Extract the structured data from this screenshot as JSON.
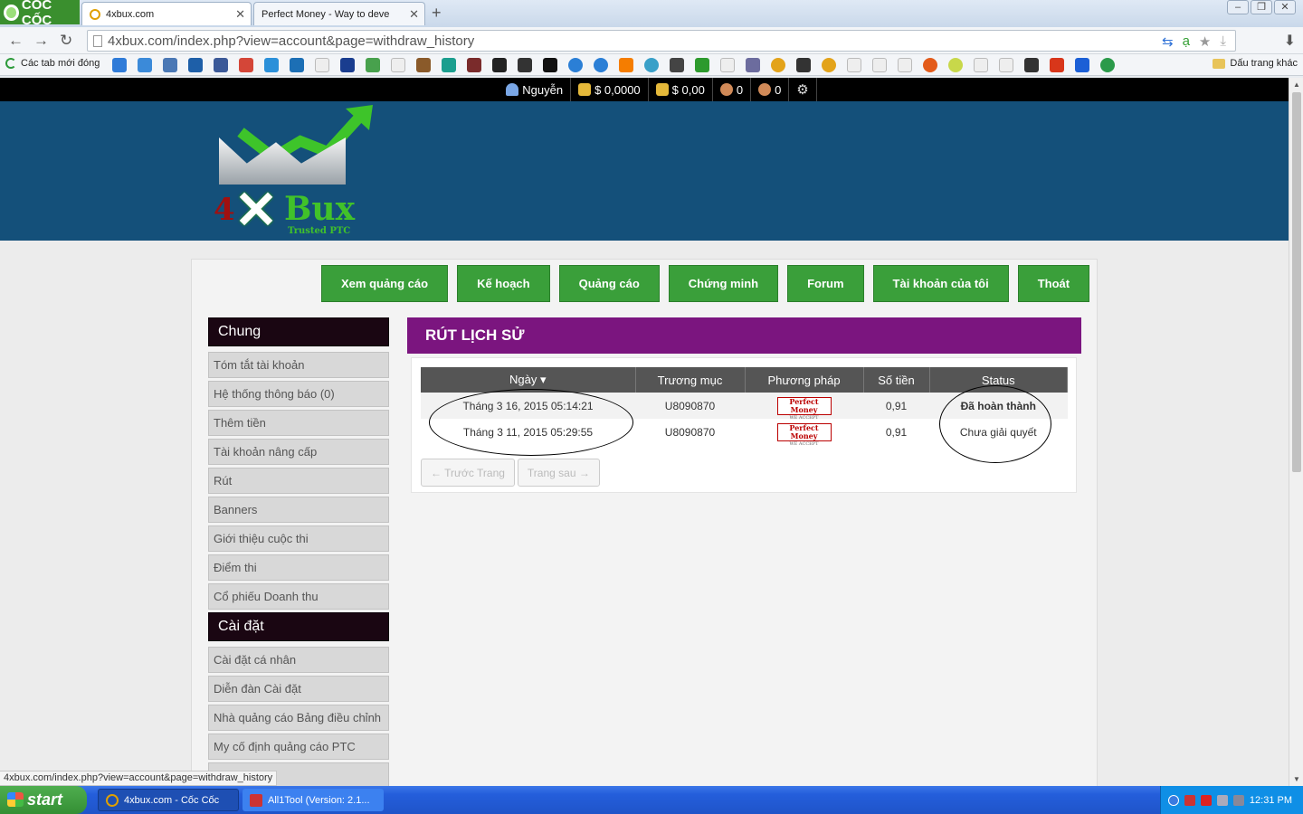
{
  "browser": {
    "brand": "CỐC CỐC",
    "tabs": [
      {
        "title": "4xbux.com",
        "active": true
      },
      {
        "title": "Perfect Money - Way to deve",
        "active": false
      }
    ],
    "url": "4xbux.com/index.php?view=account&page=withdraw_history",
    "bookmarks_first": "Các tab mới đóng",
    "bookmarks_other": "Dấu trang khác",
    "status_url": "4xbux.com/index.php?view=account&page=withdraw_history"
  },
  "topbar": {
    "username": "Nguyễn",
    "balance_1": "$ 0,0000",
    "balance_2": "$ 0,00",
    "referrals_1": "0",
    "referrals_2": "0"
  },
  "logo": {
    "four": "4",
    "bux": "Bux",
    "tagline": "Trusted PTC"
  },
  "nav": [
    "Xem quảng cáo",
    "Kế hoạch",
    "Quảng cáo",
    "Chứng minh",
    "Forum",
    "Tài khoản của tôi",
    "Thoát"
  ],
  "sidebar": {
    "section1": "Chung",
    "items1": [
      "Tóm tắt tài khoản",
      "Hệ thống thông báo (0)",
      "Thêm tiền",
      "Tài khoản nâng cấp",
      "Rút",
      "Banners",
      "Giới thiệu cuộc thi",
      "Điểm thi",
      "Cổ phiếu Doanh thu"
    ],
    "section2": "Cài đặt",
    "items2": [
      "Cài đặt cá nhân",
      "Diễn đàn Cài đặt",
      "Nhà quảng cáo Bảng điều chỉnh",
      "My cố định quảng cáo PTC"
    ]
  },
  "content": {
    "title": "RÚT LỊCH SỬ",
    "columns": [
      "Ngày ▾",
      "Trương mục",
      "Phương pháp",
      "Số tiền",
      "Status"
    ],
    "rows": [
      {
        "date": "Tháng 3 16, 2015 05:14:21",
        "account": "U8090870",
        "method": "Perfect Money",
        "amount": "0,91",
        "status": "Đã hoàn thành"
      },
      {
        "date": "Tháng 3 11, 2015 05:29:55",
        "account": "U8090870",
        "method": "Perfect Money",
        "amount": "0,91",
        "status": "Chưa giải quyết"
      }
    ],
    "pm_accept": "WE ACCEPT",
    "prev": "← Trước Trang",
    "next": "Trang sau →"
  },
  "taskbar": {
    "start": "start",
    "tasks": [
      "4xbux.com - Cốc Cốc",
      "All1Tool (Version: 2.1..."
    ],
    "clock": "12:31 PM"
  },
  "colors": {
    "nav_green": "#3a9f3a",
    "header_blue": "#14507a",
    "content_purple": "#7b157f",
    "sidebar_head": "#1a0612"
  }
}
